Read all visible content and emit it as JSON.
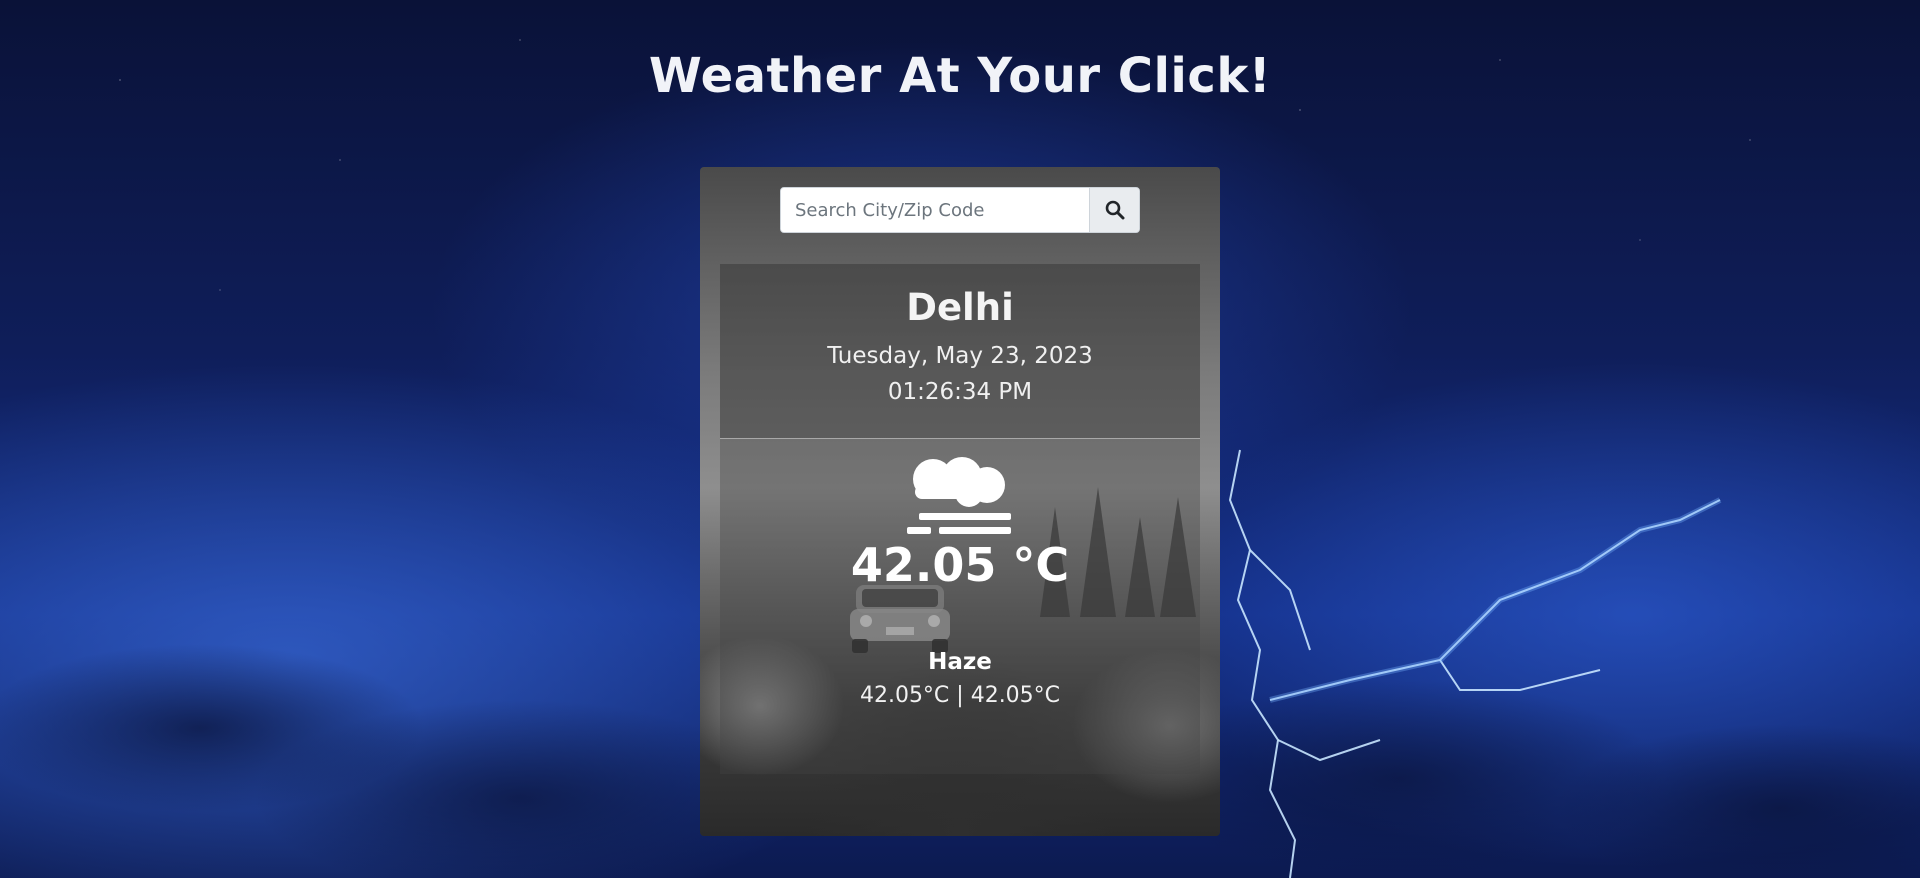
{
  "header": {
    "title": "Weather At Your Click!"
  },
  "search": {
    "placeholder": "Search City/Zip Code",
    "value": "",
    "button_icon": "search-icon"
  },
  "weather": {
    "city": "Delhi",
    "date": "Tuesday, May 23, 2023",
    "time": "01:26:34 PM",
    "icon": "haze-icon",
    "temperature": "42.05 °C",
    "condition": "Haze",
    "min_max": "42.05°C | 42.05°C"
  },
  "colors": {
    "title_text": "#f1f3f8",
    "background_top": "#0a1238",
    "background_glow": "#14308a",
    "search_button_bg": "#e9ecef"
  }
}
